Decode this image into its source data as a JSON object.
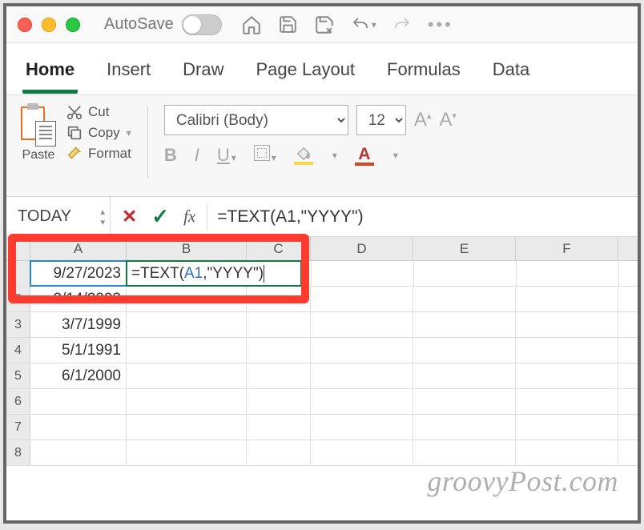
{
  "titlebar": {
    "autosave_label": "AutoSave"
  },
  "tabs": {
    "home": "Home",
    "insert": "Insert",
    "draw": "Draw",
    "page_layout": "Page Layout",
    "formulas": "Formulas",
    "data": "Data"
  },
  "ribbon": {
    "paste": "Paste",
    "cut": "Cut",
    "copy": "Copy",
    "format": "Format",
    "font_name": "Calibri (Body)",
    "font_size": "12",
    "bold": "B",
    "italic": "I",
    "underline": "U",
    "font_color_glyph": "A"
  },
  "formula_bar": {
    "name_box": "TODAY",
    "fx": "fx",
    "formula": "=TEXT(A1,\"YYYY\")"
  },
  "columns": [
    "A",
    "B",
    "C",
    "D",
    "E",
    "F"
  ],
  "rows": {
    "r1": {
      "a": "9/27/2023",
      "b_pre": "=TEXT(",
      "b_ref": "A1",
      "b_post": ",\"YYYY\")"
    },
    "r2": {
      "num": "2",
      "a": "2/14/2003"
    },
    "r3": {
      "num": "3",
      "a": "3/7/1999"
    },
    "r4": {
      "num": "4",
      "a": "5/1/1991"
    },
    "r5": {
      "num": "5",
      "a": "6/1/2000"
    },
    "r6": {
      "num": "6"
    },
    "r7": {
      "num": "7"
    },
    "r8": {
      "num": "8"
    }
  },
  "watermark": "groovyPost.com"
}
